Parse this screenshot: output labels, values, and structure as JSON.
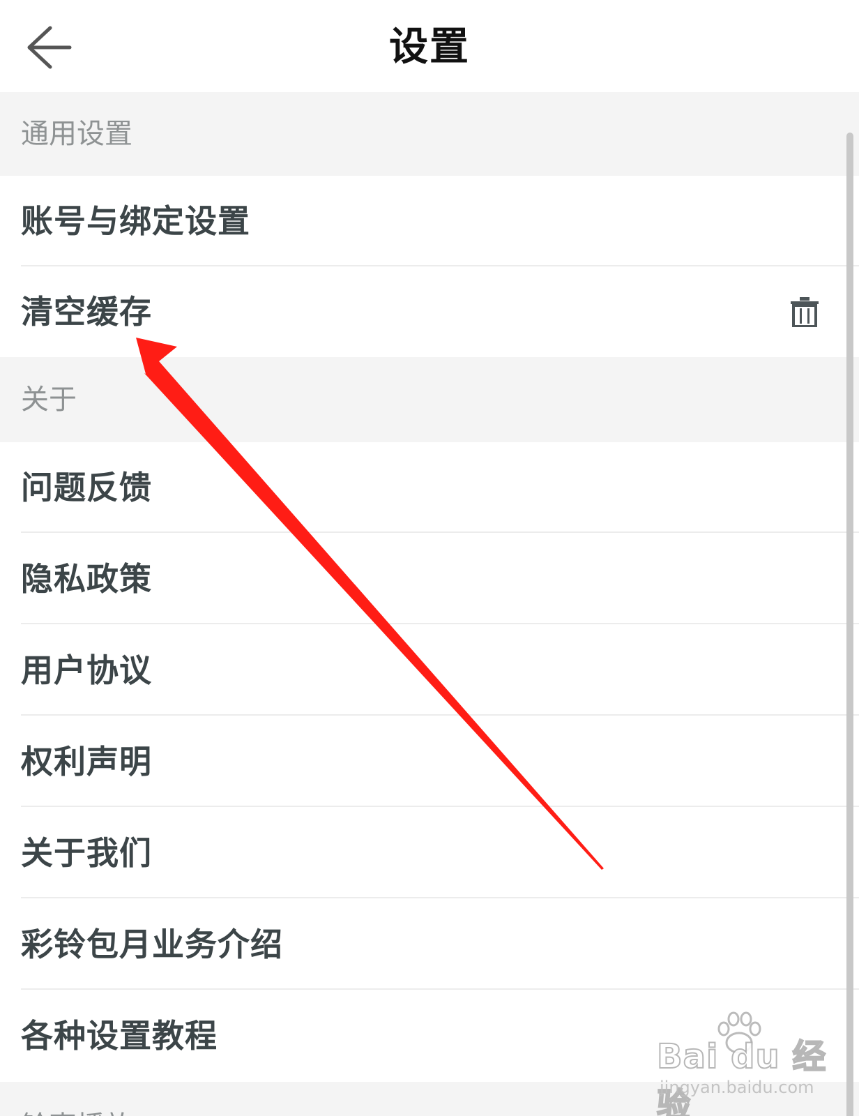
{
  "nav": {
    "title": "设置"
  },
  "sections": [
    {
      "header": "通用设置",
      "items": [
        {
          "label": "账号与绑定设置"
        },
        {
          "label": "清空缓存",
          "icon": "trash-icon"
        }
      ]
    },
    {
      "header": "关于",
      "items": [
        {
          "label": "问题反馈"
        },
        {
          "label": "隐私政策"
        },
        {
          "label": "用户协议"
        },
        {
          "label": "权利声明"
        },
        {
          "label": "关于我们"
        },
        {
          "label": "彩铃包月业务介绍"
        },
        {
          "label": "各种设置教程"
        }
      ]
    },
    {
      "header": "铃声播放"
    }
  ],
  "annotation": {
    "color": "#ff1d15"
  },
  "watermark": {
    "logo": "Bai du 经验",
    "url": "jingyan.baidu.com"
  }
}
